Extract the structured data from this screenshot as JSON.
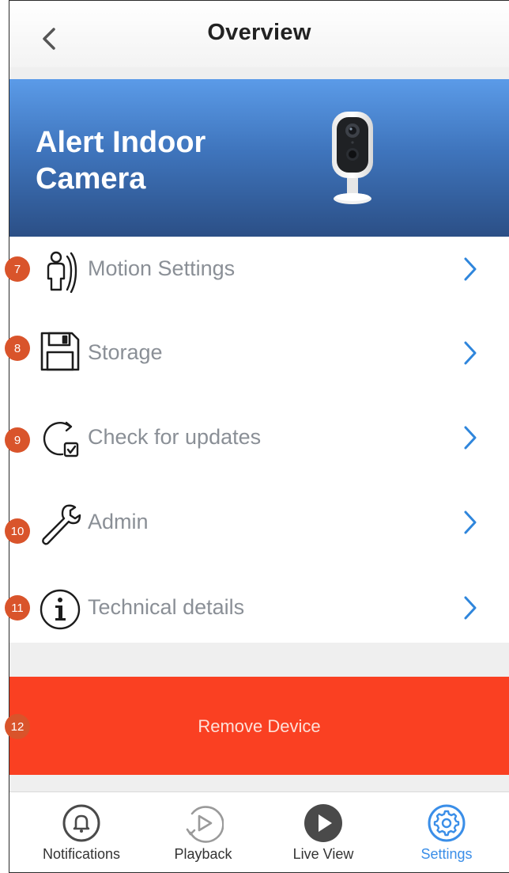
{
  "header": {
    "title": "Overview",
    "back_icon": "chevron-left-icon"
  },
  "banner": {
    "title": "Alert Indoor Camera",
    "image": "indoor-camera-image"
  },
  "menu": {
    "items": [
      {
        "label": "Motion Settings",
        "icon": "motion-person-icon",
        "badge": "7"
      },
      {
        "label": "Storage",
        "icon": "floppy-disk-icon",
        "badge": "8"
      },
      {
        "label": "Check for updates",
        "icon": "update-check-icon",
        "badge": "9"
      },
      {
        "label": "Admin",
        "icon": "wrench-icon",
        "badge": "10"
      },
      {
        "label": "Technical details",
        "icon": "info-icon",
        "badge": "11"
      }
    ]
  },
  "remove": {
    "label": "Remove Device",
    "badge": "12",
    "color": "#fa4022"
  },
  "tabbar": {
    "tabs": [
      {
        "label": "Notifications",
        "icon": "bell-icon",
        "active": false
      },
      {
        "label": "Playback",
        "icon": "playback-icon",
        "active": false
      },
      {
        "label": "Live View",
        "icon": "play-circle-icon",
        "active": false
      },
      {
        "label": "Settings",
        "icon": "gear-icon",
        "active": true
      }
    ]
  },
  "colors": {
    "accent": "#3a8ee8",
    "badge": "#d9542b",
    "banner_top": "#5b9be8",
    "banner_bottom": "#2b4f86"
  }
}
